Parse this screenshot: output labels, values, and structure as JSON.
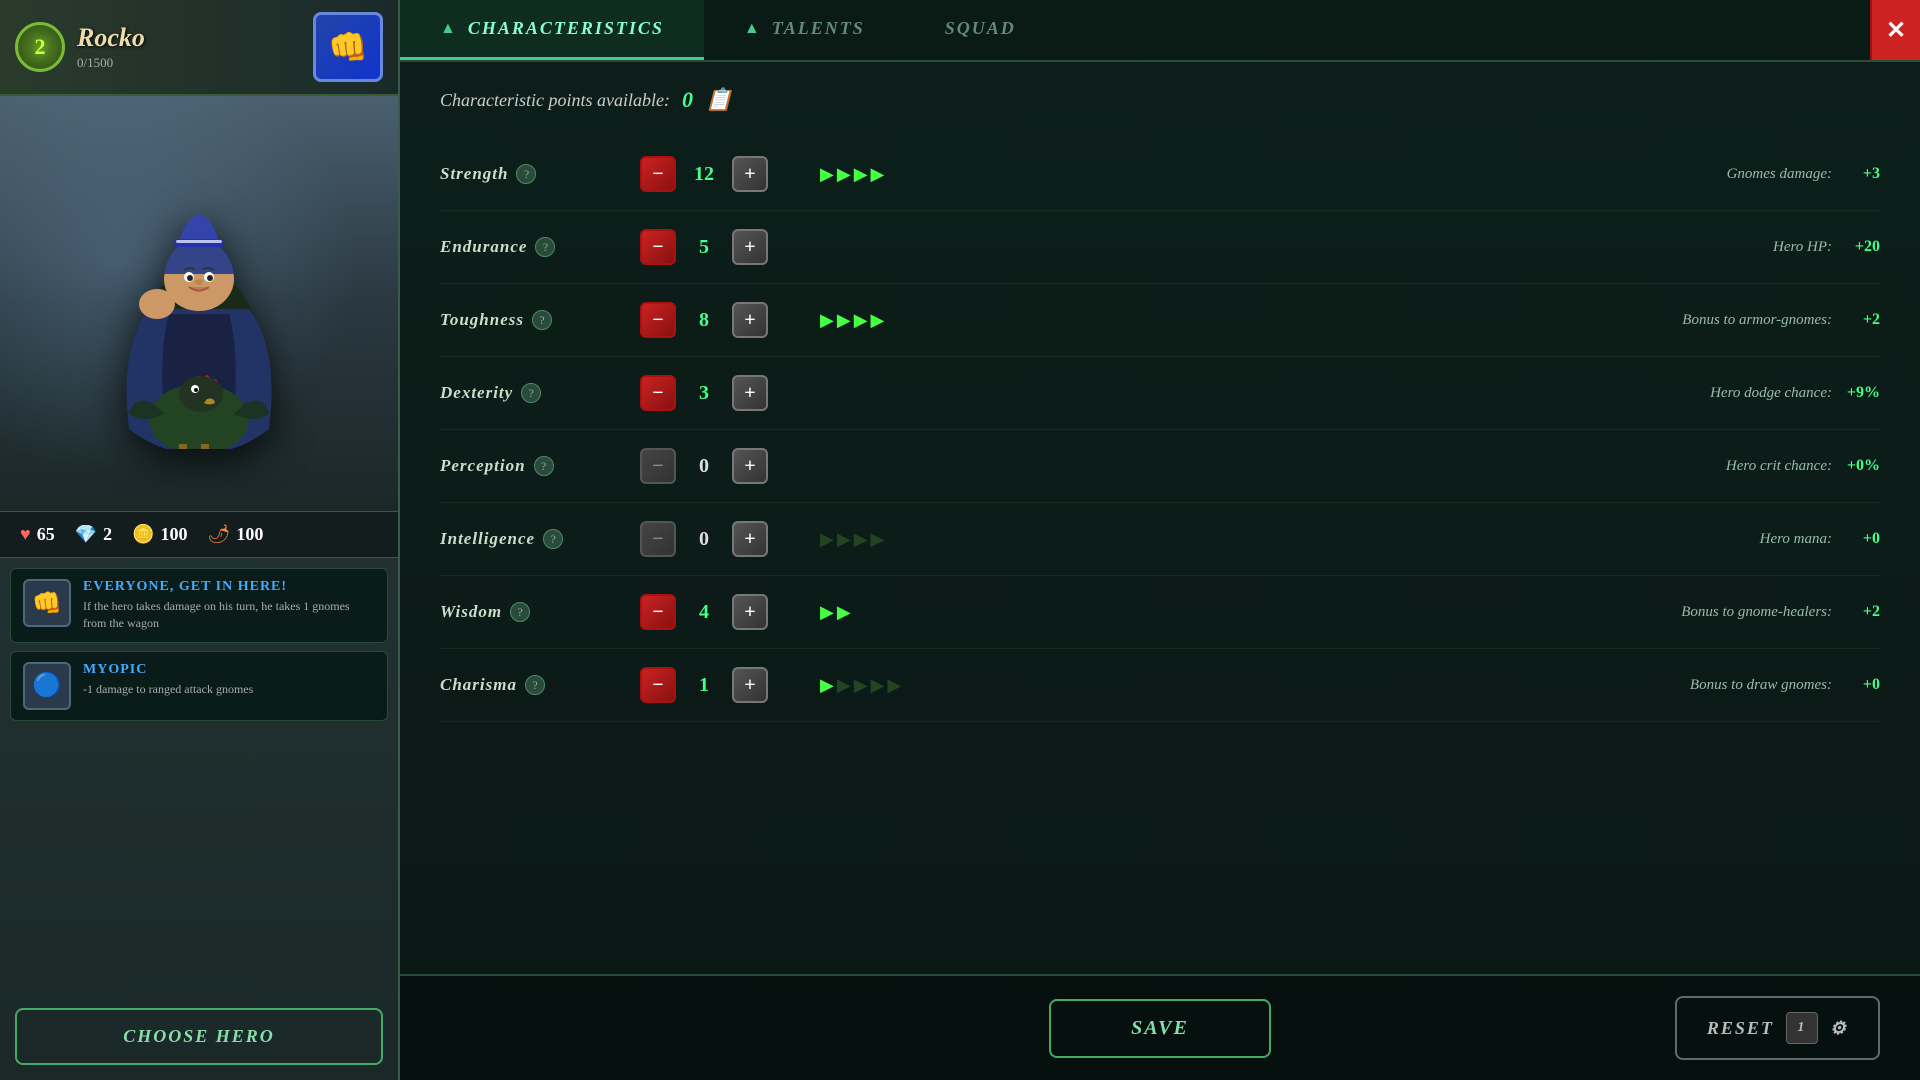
{
  "hero": {
    "name": "Rocko",
    "level": 2,
    "xp": "0/1500",
    "emblem": "👊",
    "sprite": "🐦",
    "stats": {
      "hp": 65,
      "blue": 2,
      "gold": 100,
      "red": 100
    }
  },
  "traits": [
    {
      "id": "everyone-get-in-here",
      "name": "Everyone, get in here!",
      "description": "If the hero takes damage on his turn, he takes 1 gnomes from the wagon",
      "icon": "👊"
    },
    {
      "id": "myopic",
      "name": "Myopic",
      "description": "-1 damage to ranged attack gnomes",
      "icon": "🔵"
    }
  ],
  "tabs": [
    {
      "id": "characteristics",
      "label": "Characteristics",
      "active": true
    },
    {
      "id": "talents",
      "label": "Talents",
      "active": false
    },
    {
      "id": "squad",
      "label": "Squad",
      "active": false
    }
  ],
  "characteristics": {
    "points_label": "Characteristic points available:",
    "points": 0,
    "stats": [
      {
        "id": "strength",
        "label": "Strength",
        "value": 12,
        "value_color": "green",
        "arrows": 4,
        "max_arrows": 4,
        "minus_active": true,
        "effect_label": "Gnomes damage:",
        "effect_value": "+3"
      },
      {
        "id": "endurance",
        "label": "Endurance",
        "value": 5,
        "value_color": "green",
        "arrows": 0,
        "max_arrows": 0,
        "minus_active": true,
        "effect_label": "Hero HP:",
        "effect_value": "+20"
      },
      {
        "id": "toughness",
        "label": "Toughness",
        "value": 8,
        "value_color": "green",
        "arrows": 4,
        "max_arrows": 4,
        "minus_active": true,
        "effect_label": "Bonus to armor-gnomes:",
        "effect_value": "+2"
      },
      {
        "id": "dexterity",
        "label": "Dexterity",
        "value": 3,
        "value_color": "green",
        "arrows": 0,
        "max_arrows": 0,
        "minus_active": true,
        "effect_label": "Hero dodge chance:",
        "effect_value": "+9%"
      },
      {
        "id": "perception",
        "label": "Perception",
        "value": 0,
        "value_color": "white",
        "arrows": 0,
        "max_arrows": 0,
        "minus_active": false,
        "effect_label": "Hero crit chance:",
        "effect_value": "+0%"
      },
      {
        "id": "intelligence",
        "label": "Intelligence",
        "value": 0,
        "value_color": "white",
        "arrows": 4,
        "max_arrows": 4,
        "minus_active": false,
        "effect_label": "Hero mana:",
        "effect_value": "+0"
      },
      {
        "id": "wisdom",
        "label": "Wisdom",
        "value": 4,
        "value_color": "green",
        "arrows": 2,
        "max_arrows": 4,
        "minus_active": true,
        "effect_label": "Bonus to gnome-healers:",
        "effect_value": "+2"
      },
      {
        "id": "charisma",
        "label": "Charisma",
        "value": 1,
        "value_color": "green",
        "arrows": 1,
        "max_arrows": 5,
        "minus_active": true,
        "effect_label": "Bonus to draw gnomes:",
        "effect_value": "+0"
      }
    ]
  },
  "buttons": {
    "choose_hero": "Choose Hero",
    "save": "Save",
    "reset": "Reset",
    "reset_count": "1"
  }
}
